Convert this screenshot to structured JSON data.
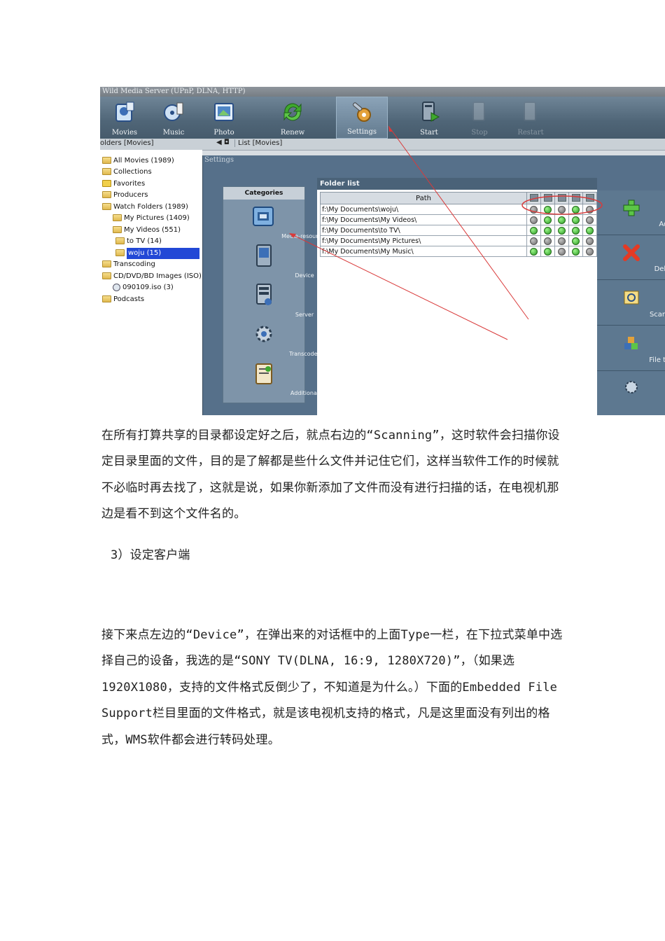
{
  "screenshot": {
    "app_title": "Wild Media Server (UPnP, DLNA, HTTP)",
    "toolbar": [
      {
        "label": "Movies",
        "icon": "movies-icon",
        "state": "normal"
      },
      {
        "label": "Music",
        "icon": "music-icon",
        "state": "normal"
      },
      {
        "label": "Photo",
        "icon": "photo-icon",
        "state": "normal"
      },
      {
        "label": "Renew",
        "icon": "renew-icon",
        "state": "normal"
      },
      {
        "label": "Settings",
        "icon": "settings-icon",
        "state": "active"
      },
      {
        "label": "Start",
        "icon": "start-icon",
        "state": "normal"
      },
      {
        "label": "Stop",
        "icon": "stop-icon",
        "state": "disabled"
      },
      {
        "label": "Restart",
        "icon": "restart-icon",
        "state": "disabled"
      }
    ],
    "subbar": {
      "left": "olders [Movies]",
      "nav": "◀ ◘",
      "right": "List [Movies]"
    },
    "tree": [
      {
        "label": "All Movies (1989)"
      },
      {
        "label": "Collections"
      },
      {
        "label": "Favorites"
      },
      {
        "label": "Producers"
      },
      {
        "label": "Watch Folders (1989)"
      },
      {
        "label": "My Pictures (1409)"
      },
      {
        "label": "My Videos (551)"
      },
      {
        "label": "to TV (14)"
      },
      {
        "label": "woju (15)",
        "selected": true
      },
      {
        "label": "Transcoding"
      },
      {
        "label": "CD/DVD/BD Images (ISO)"
      },
      {
        "label": "090109.iso (3)"
      },
      {
        "label": "Podcasts"
      }
    ],
    "settings": {
      "window_title": "Settings",
      "categories_header": "Categories",
      "categories": [
        {
          "label": "Media-resources",
          "icon": "media-resources-icon",
          "selected": true
        },
        {
          "label": "Device",
          "icon": "device-icon"
        },
        {
          "label": "Server",
          "icon": "server-icon"
        },
        {
          "label": "Transcoder",
          "icon": "transcoder-icon"
        },
        {
          "label": "Additional",
          "icon": "additional-icon"
        }
      ],
      "folder_list_title": "Folder list",
      "path_header": "Path",
      "folders": [
        {
          "path": "f:\\My Documents\\woju\\",
          "flags": [
            false,
            true,
            false,
            true,
            false
          ]
        },
        {
          "path": "f:\\My Documents\\My Videos\\",
          "flags": [
            false,
            true,
            true,
            true,
            false
          ]
        },
        {
          "path": "f:\\My Documents\\to TV\\",
          "flags": [
            true,
            true,
            true,
            true,
            true
          ]
        },
        {
          "path": "f:\\My Documents\\My Pictures\\",
          "flags": [
            false,
            false,
            false,
            true,
            false
          ]
        },
        {
          "path": "f:\\My Documents\\My Music\\",
          "flags": [
            true,
            true,
            false,
            true,
            false
          ]
        }
      ],
      "actions": [
        {
          "label": "Add",
          "icon": "add-icon"
        },
        {
          "label": "Delete",
          "icon": "delete-icon"
        },
        {
          "label": "Scanning",
          "icon": "scanning-icon"
        },
        {
          "label": "File types",
          "icon": "file-types-icon"
        },
        {
          "label": "",
          "icon": "more-icon"
        }
      ]
    },
    "colors": {
      "annotation": "#d93a3a",
      "toolbar": "#4f6577",
      "selection": "#2248d6"
    }
  },
  "article": {
    "para1": "在所有打算共享的目录都设定好之后，就点右边的“Scanning”，这时软件会扫描你设定目录里面的文件，目的是了解都是些什么文件并记住它们，这样当软件工作的时候就不必临时再去找了，这就是说，如果你新添加了文件而没有进行扫描的话，在电视机那边是看不到这个文件名的。",
    "heading": "3）设定客户端",
    "para2": "接下来点左边的“Device”，在弹出来的对话框中的上面Type一栏，在下拉式菜单中选择自己的设备，我选的是“SONY TV(DLNA, 16:9, 1280X720)”，（如果选1920X1080，支持的文件格式反倒少了，不知道是为什么。）下面的Embedded File Support栏目里面的文件格式，就是该电视机支持的格式，凡是这里面没有列出的格式，WMS软件都会进行转码处理。"
  }
}
